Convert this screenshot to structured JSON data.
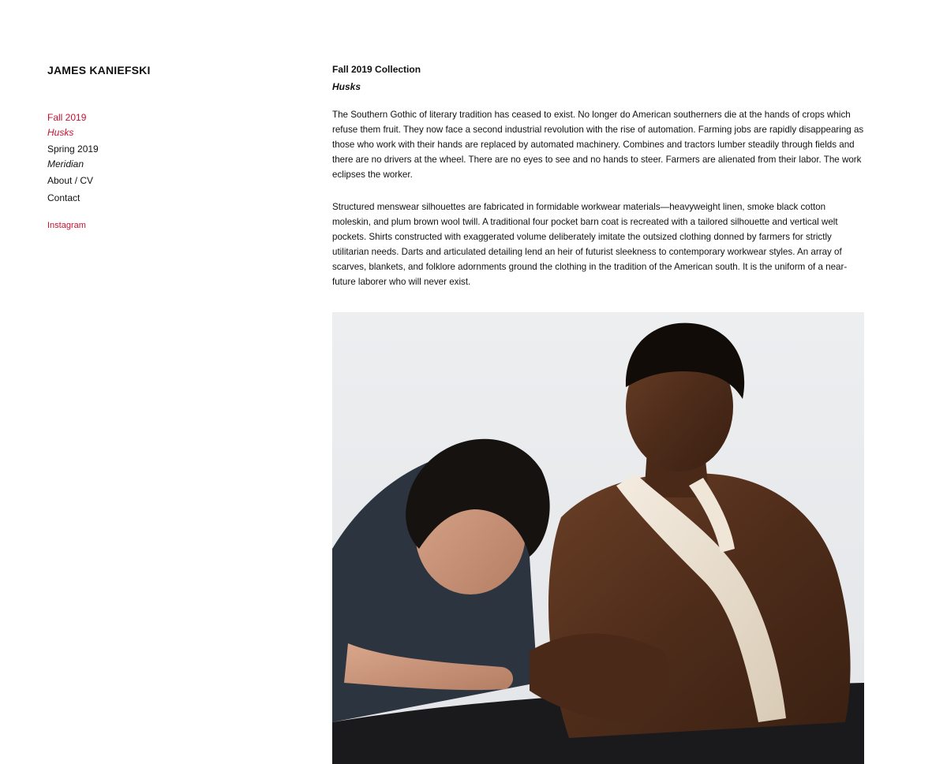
{
  "site": {
    "title": "JAMES KANIEFSKI"
  },
  "nav": {
    "items": [
      {
        "label": "Fall 2019"
      },
      {
        "label": "Husks"
      },
      {
        "label": "Spring 2019"
      },
      {
        "label": "Meridian"
      },
      {
        "label": "About / CV"
      },
      {
        "label": "Contact"
      }
    ],
    "instagram": "Instagram"
  },
  "collection": {
    "title": "Fall 2019 Collection",
    "name": "Husks",
    "paragraphs": [
      "The Southern Gothic of literary tradition has ceased to exist. No longer do American southerners die at the hands of crops which refuse them fruit. They now face a second industrial revolution with the rise of automation. Farming jobs are rapidly disappearing as those who work with their hands are replaced by automated machinery. Combines and tractors lumber steadily through fields and there are no drivers at the wheel. There are no eyes to see and no hands to steer. Farmers are alienated from their labor. The work eclipses the worker.",
      "Structured menswear silhouettes are fabricated in formidable workwear materials—heavyweight linen, smoke black cotton moleskin, and plum brown wool twill. A traditional four pocket barn coat is recreated with a tailored silhouette and vertical welt pockets. Shirts constructed with exaggerated volume deliberately imitate the outsized clothing donned by farmers for strictly utilitarian needs. Darts and articulated detailing lend an heir of futurist sleekness to contemporary workwear styles. An array of scarves, blankets, and folklore adornments ground the clothing in the tradition of the American south. It is the uniform of a near-future laborer who will never exist."
    ]
  },
  "colors": {
    "accent": "#c8102e",
    "text": "#111111",
    "background": "#ffffff"
  }
}
